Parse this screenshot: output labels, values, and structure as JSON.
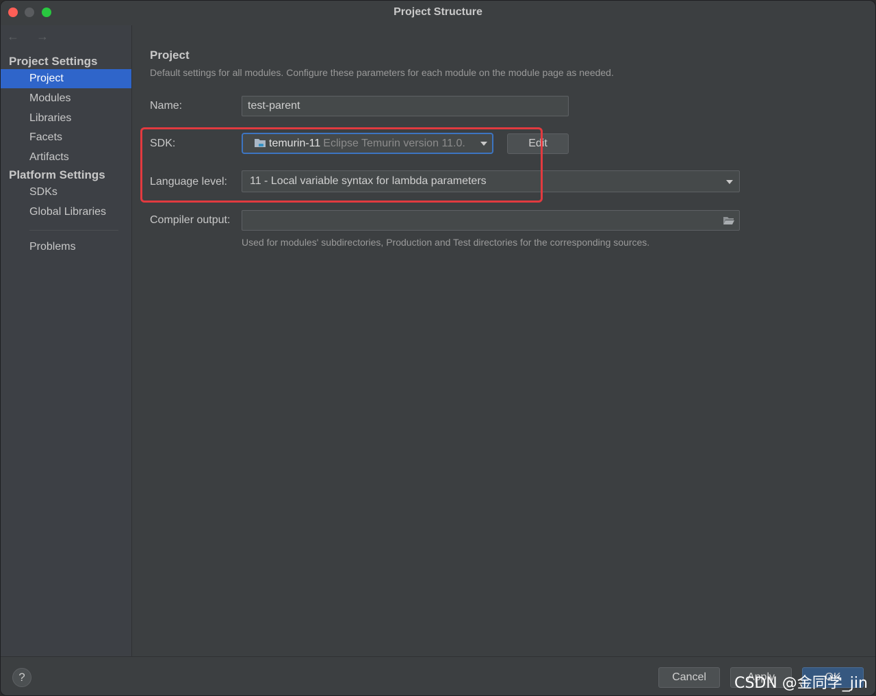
{
  "window": {
    "title": "Project Structure"
  },
  "sidebar": {
    "nav_arrows": "← →",
    "project_settings_label": "Project Settings",
    "project_items": [
      {
        "label": "Project",
        "selected": true
      },
      {
        "label": "Modules"
      },
      {
        "label": "Libraries"
      },
      {
        "label": "Facets"
      },
      {
        "label": "Artifacts"
      }
    ],
    "platform_settings_label": "Platform Settings",
    "platform_items": [
      {
        "label": "SDKs"
      },
      {
        "label": "Global Libraries"
      }
    ],
    "problems_label": "Problems"
  },
  "main": {
    "title": "Project",
    "description": "Default settings for all modules. Configure these parameters for each module on the module page as needed.",
    "name_label": "Name:",
    "name_value": "test-parent",
    "sdk_label": "SDK:",
    "sdk_name": "temurin-11",
    "sdk_version": "Eclipse Temurin version 11.0.",
    "edit_label": "Edit",
    "language_level_label": "Language level:",
    "language_level_value": "11 - Local variable syntax for lambda parameters",
    "compiler_output_label": "Compiler output:",
    "compiler_output_value": "",
    "compiler_output_hint": "Used for modules' subdirectories, Production and Test directories for the corresponding sources."
  },
  "footer": {
    "help_label": "?",
    "cancel_label": "Cancel",
    "apply_label": "Apply",
    "ok_label": "OK",
    "watermark": "CSDN @金同学_jin"
  },
  "colors": {
    "accent": "#2f65ca",
    "highlight": "#e23a3f",
    "background": "#3c3f41"
  }
}
